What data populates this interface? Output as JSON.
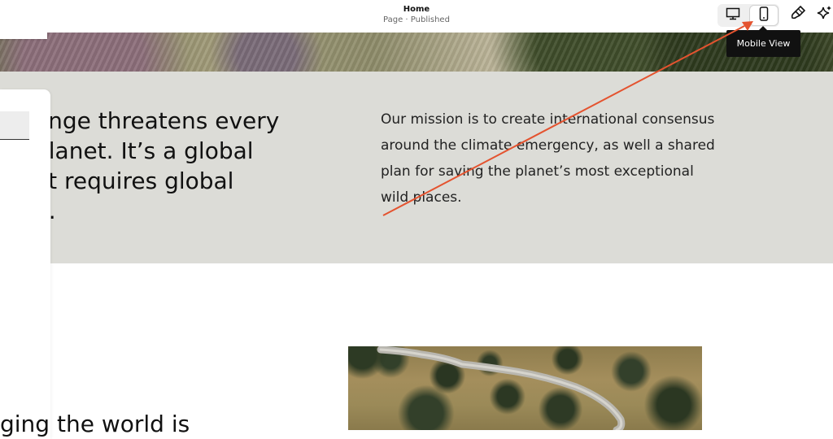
{
  "topbar": {
    "title": "Home",
    "subtitle": "Page · Published"
  },
  "view_toggle": {
    "desktop_icon": "desktop-monitor-icon",
    "mobile_icon": "mobile-phone-icon",
    "active": "mobile"
  },
  "tools": {
    "design_icon": "paintbrush-icon",
    "ai_icon": "sparkle-icon"
  },
  "tooltip": {
    "text": "Mobile View"
  },
  "content": {
    "headline": "ange threatens every\nplanet. It’s a global\nat requires global\nn.",
    "mission": "Our mission is to create international consensus around the climate emergency, as well a shared plan for saving the planet’s most exceptional wild places.",
    "bottom_headline": "ging the world is"
  },
  "annotation": {
    "arrow_color": "#e4532f"
  },
  "colors": {
    "band_background": "#dcdcd7",
    "tooltip_background": "#111111"
  }
}
